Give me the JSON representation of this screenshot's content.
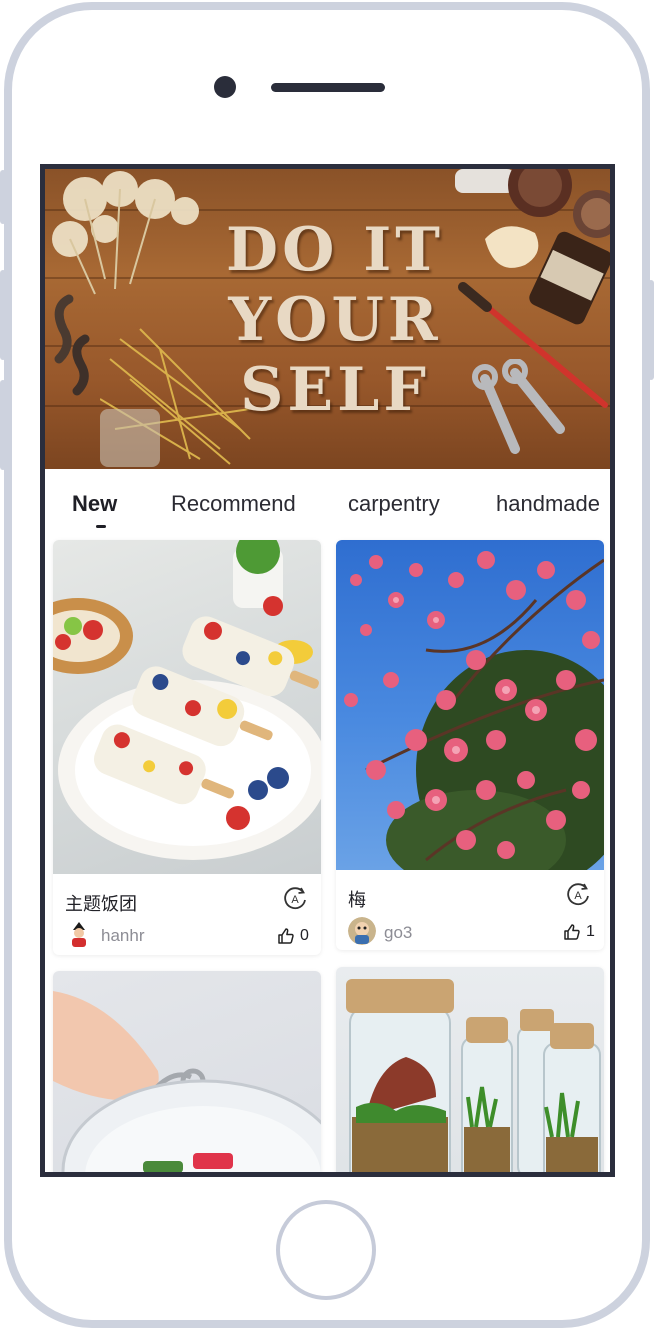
{
  "banner": {
    "lines": [
      "DO IT",
      "YOUR",
      "SELF"
    ]
  },
  "tabs": [
    {
      "label": "New",
      "active": true
    },
    {
      "label": "Recommend",
      "active": false
    },
    {
      "label": "carpentry",
      "active": false
    },
    {
      "label": "handmade",
      "active": false
    }
  ],
  "feed": [
    {
      "title": "主题饭团",
      "user": "hanhr",
      "likes": "0",
      "image_icon": "rice-popsicle-image"
    },
    {
      "title": "梅",
      "user": "go3",
      "likes": "1",
      "image_icon": "plum-blossom-image"
    },
    {
      "title": "",
      "user": "",
      "likes": "",
      "image_icon": "keychain-image"
    },
    {
      "title": "",
      "user": "",
      "likes": "",
      "image_icon": "terrarium-jars-image"
    }
  ],
  "colors": {
    "phone_frame": "#cdd2de",
    "screen_bezel": "#2b2e3d",
    "text_primary": "#222228",
    "text_secondary": "#8d8d95"
  }
}
